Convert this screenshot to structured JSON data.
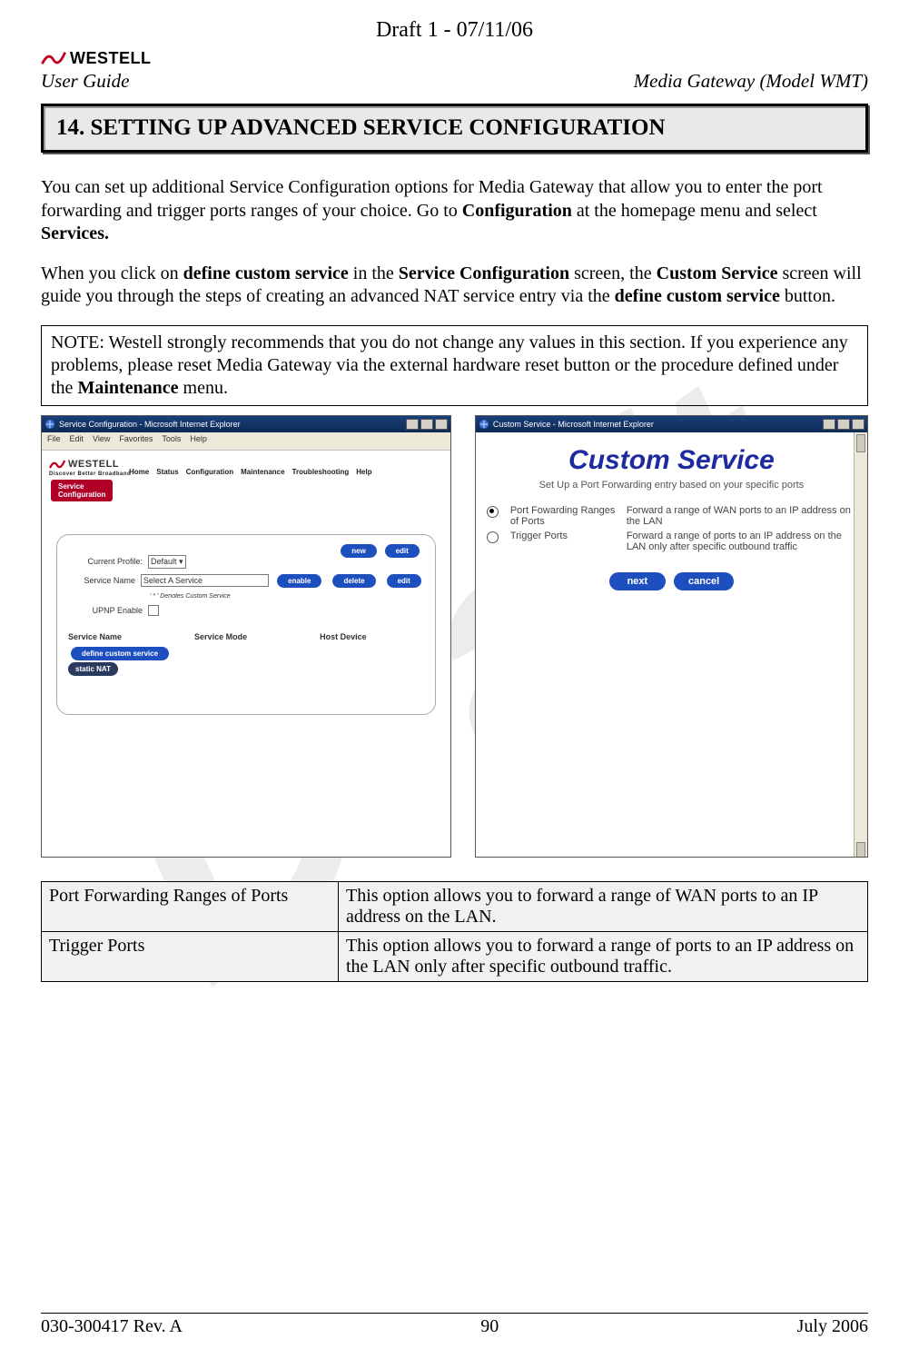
{
  "doc": {
    "draft_label": "Draft 1 - 07/11/06",
    "user_guide": "User Guide",
    "model": "Media Gateway (Model WMT)",
    "watermark": "Draft"
  },
  "section": {
    "title": "14.  SETTING UP ADVANCED SERVICE CONFIGURATION"
  },
  "para1": {
    "a": "You can set up additional Service Configuration options for Media Gateway that allow you to enter the port forwarding and trigger ports ranges of your choice. Go to ",
    "b": "Configuration",
    "c": " at the homepage menu and select ",
    "d": "Services."
  },
  "para2": {
    "a": "When you click on ",
    "b": "define custom service",
    "c": " in the ",
    "d": "Service Configuration",
    "e": " screen, the ",
    "f": "Custom Service",
    "g": " screen will guide you through the steps of creating an advanced NAT service entry via the ",
    "h": "define custom service",
    "i": " button."
  },
  "note": {
    "a": "NOTE: Westell strongly recommends that you do not change any values in this section. If you experience any problems, please reset Media Gateway via the external hardware reset button or the procedure defined under the ",
    "b": "Maintenance",
    "c": " menu."
  },
  "scr_left": {
    "title": "Service Configuration - Microsoft Internet Explorer",
    "menu": [
      "File",
      "Edit",
      "View",
      "Favorites",
      "Tools",
      "Help"
    ],
    "brand": "WESTELL",
    "tagline": "Discover Better Broadband",
    "nav": [
      "Home",
      "Status",
      "Configuration",
      "Maintenance",
      "Troubleshooting",
      "Help"
    ],
    "active_tab_l1": "Service",
    "active_tab_l2": "Configuration",
    "current_profile_lbl": "Current Profile:",
    "current_profile_val": "Default",
    "service_name_lbl": "Service Name",
    "service_name_val": "Select A Service",
    "denotes": "' * ' Denotes Custom Service",
    "upnp_lbl": "UPNP Enable",
    "btn_new": "new",
    "btn_edit": "edit",
    "btn_enable": "enable",
    "btn_delete": "delete",
    "col1": "Service Name",
    "col2": "Service Mode",
    "col3": "Host Device",
    "define_btn": "define custom service",
    "static_btn": "static NAT"
  },
  "scr_right": {
    "title": "Custom Service - Microsoft Internet Explorer",
    "heading": "Custom Service",
    "sub": "Set Up a Port Forwarding entry based on your specific ports",
    "opt1_label": "Port Fowarding Ranges of Ports",
    "opt1_desc": "Forward a range of WAN ports to an IP address on the LAN",
    "opt2_label": "Trigger Ports",
    "opt2_desc": "Forward a range of ports to an IP address on the LAN only after specific outbound traffic",
    "btn_next": "next",
    "btn_cancel": "cancel"
  },
  "opts_table": {
    "r1c1": "Port Forwarding Ranges of Ports",
    "r1c2": "This option allows you to forward a range of WAN ports to an IP address on the LAN.",
    "r2c1": "Trigger Ports",
    "r2c2": "This option allows you to forward a range of ports to an IP address on the LAN only after specific outbound traffic."
  },
  "footer": {
    "left": "030-300417 Rev. A",
    "center": "90",
    "right": "July 2006"
  }
}
